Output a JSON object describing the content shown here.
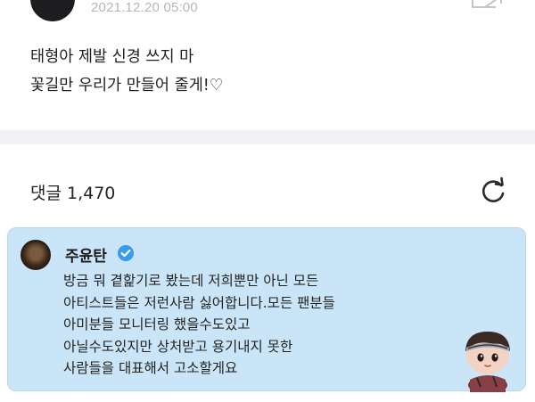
{
  "post": {
    "date": "2021.12.20 05:00",
    "lines": [
      "태형아 제발 신경 쓰지 마",
      "꽃길만 우리가 만들어 줄게!♡"
    ]
  },
  "comments": {
    "label_count": "댓글 1,470"
  },
  "comment": {
    "author": "주윤탄",
    "lines": [
      "방금 뭐 곁핥기로 봤는데 저희뿐만 아닌 모든",
      "아티스트들은 저런사람 싫어합니다.모든 팬분들",
      "아미분들 모니터링 했을수도있고",
      "아닐수도있지만 상처받고 용기내지 못한",
      "사람들을 대표해서 고소할게요"
    ]
  },
  "icons": {
    "share": "share-icon",
    "refresh": "refresh-icon",
    "verified": "verified-icon"
  },
  "colors": {
    "card_background": "#cbe5f8",
    "verified": "#3a9be8",
    "divider": "#f2f2f4"
  }
}
